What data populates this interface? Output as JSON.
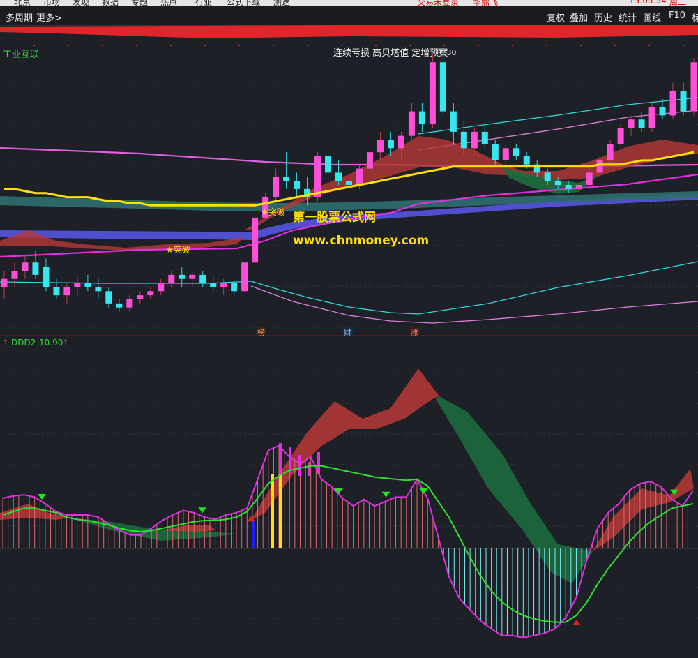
{
  "top_menu": {
    "items": [
      "北京",
      "市场",
      "发现",
      "数据",
      "专题",
      "热点",
      "行业",
      "公式下载",
      "测速"
    ],
    "notice": "交易未登录",
    "brand": "华鼎飞",
    "clock": "15:05:54",
    "weekday": "周二"
  },
  "toolbar": {
    "left_items": [
      "多周期",
      "更多>"
    ],
    "right_items": [
      "复权",
      "叠加",
      "历史",
      "统计",
      "画线",
      "F10",
      "标"
    ]
  },
  "main_panel": {
    "stock_label": "工业互联",
    "event_title": "连续亏损 高贝塔值 定增预案",
    "price_label": "6.30",
    "breakout_labels": [
      "★突破",
      "★突破"
    ],
    "watermark_line1": "第一股票公式网",
    "watermark_line2": "www.chnmoney.com",
    "event_markers": [
      "榜",
      "财",
      "涨"
    ],
    "colors": {
      "bull": "#ff4fd8",
      "bear": "#39e6ef",
      "yellow": "#ffe000",
      "green": "#00a050",
      "blue_band": "#5a5af0",
      "teal_band": "#2f6e6e"
    }
  },
  "indicator_panel": {
    "name": "DDD2",
    "value": "10.90",
    "arrow": "↑"
  },
  "chart_data": [
    {
      "type": "candlestick",
      "candles": [
        {
          "o": 3.0,
          "h": 3.4,
          "l": 2.7,
          "c": 3.2
        },
        {
          "o": 3.2,
          "h": 3.6,
          "l": 3.0,
          "c": 3.4
        },
        {
          "o": 3.4,
          "h": 3.8,
          "l": 3.2,
          "c": 3.6
        },
        {
          "o": 3.6,
          "h": 3.9,
          "l": 3.2,
          "c": 3.3
        },
        {
          "o": 3.5,
          "h": 3.7,
          "l": 2.9,
          "c": 3.0
        },
        {
          "o": 3.0,
          "h": 3.2,
          "l": 2.7,
          "c": 2.8
        },
        {
          "o": 2.8,
          "h": 3.1,
          "l": 2.6,
          "c": 3.0
        },
        {
          "o": 3.0,
          "h": 3.3,
          "l": 2.8,
          "c": 3.1
        },
        {
          "o": 3.1,
          "h": 3.3,
          "l": 2.9,
          "c": 3.0
        },
        {
          "o": 3.0,
          "h": 3.2,
          "l": 2.7,
          "c": 2.9
        },
        {
          "o": 2.9,
          "h": 3.0,
          "l": 2.5,
          "c": 2.6
        },
        {
          "o": 2.6,
          "h": 2.7,
          "l": 2.4,
          "c": 2.5
        },
        {
          "o": 2.5,
          "h": 2.8,
          "l": 2.4,
          "c": 2.7
        },
        {
          "o": 2.7,
          "h": 2.9,
          "l": 2.6,
          "c": 2.8
        },
        {
          "o": 2.8,
          "h": 3.0,
          "l": 2.7,
          "c": 2.9
        },
        {
          "o": 2.9,
          "h": 3.2,
          "l": 2.8,
          "c": 3.1
        },
        {
          "o": 3.1,
          "h": 3.4,
          "l": 3.0,
          "c": 3.3
        },
        {
          "o": 3.3,
          "h": 3.5,
          "l": 3.0,
          "c": 3.2
        },
        {
          "o": 3.2,
          "h": 3.4,
          "l": 3.0,
          "c": 3.3
        },
        {
          "o": 3.3,
          "h": 3.4,
          "l": 3.0,
          "c": 3.1
        },
        {
          "o": 3.1,
          "h": 3.3,
          "l": 2.9,
          "c": 3.0
        },
        {
          "o": 3.0,
          "h": 3.2,
          "l": 2.8,
          "c": 3.1
        },
        {
          "o": 3.1,
          "h": 3.2,
          "l": 2.8,
          "c": 2.9
        },
        {
          "o": 2.9,
          "h": 3.6,
          "l": 2.9,
          "c": 3.6
        },
        {
          "o": 3.6,
          "h": 4.8,
          "l": 3.6,
          "c": 4.7
        },
        {
          "o": 4.7,
          "h": 5.3,
          "l": 4.7,
          "c": 5.2
        },
        {
          "o": 5.2,
          "h": 5.9,
          "l": 5.0,
          "c": 5.7
        },
        {
          "o": 5.7,
          "h": 6.3,
          "l": 5.4,
          "c": 5.6
        },
        {
          "o": 5.6,
          "h": 5.8,
          "l": 5.2,
          "c": 5.4
        },
        {
          "o": 5.4,
          "h": 5.7,
          "l": 5.0,
          "c": 5.2
        },
        {
          "o": 5.2,
          "h": 6.3,
          "l": 5.1,
          "c": 6.2
        },
        {
          "o": 6.2,
          "h": 6.4,
          "l": 5.7,
          "c": 5.8
        },
        {
          "o": 5.8,
          "h": 6.1,
          "l": 5.5,
          "c": 5.6
        },
        {
          "o": 5.6,
          "h": 5.9,
          "l": 5.3,
          "c": 5.5
        },
        {
          "o": 5.5,
          "h": 6.0,
          "l": 5.4,
          "c": 5.9
        },
        {
          "o": 5.9,
          "h": 6.4,
          "l": 5.8,
          "c": 6.3
        },
        {
          "o": 6.3,
          "h": 6.8,
          "l": 6.1,
          "c": 6.6
        },
        {
          "o": 6.6,
          "h": 6.8,
          "l": 6.2,
          "c": 6.4
        },
        {
          "o": 6.4,
          "h": 6.8,
          "l": 6.1,
          "c": 6.7
        },
        {
          "o": 6.7,
          "h": 7.5,
          "l": 6.6,
          "c": 7.3
        },
        {
          "o": 7.3,
          "h": 7.5,
          "l": 6.8,
          "c": 7.0
        },
        {
          "o": 7.0,
          "h": 8.7,
          "l": 6.9,
          "c": 8.5
        },
        {
          "o": 8.5,
          "h": 8.7,
          "l": 7.2,
          "c": 7.3
        },
        {
          "o": 7.3,
          "h": 7.5,
          "l": 6.5,
          "c": 6.8
        },
        {
          "o": 6.8,
          "h": 7.1,
          "l": 6.2,
          "c": 6.4
        },
        {
          "o": 6.4,
          "h": 6.9,
          "l": 6.2,
          "c": 6.8
        },
        {
          "o": 6.8,
          "h": 7.0,
          "l": 6.4,
          "c": 6.5
        },
        {
          "o": 6.5,
          "h": 6.6,
          "l": 6.0,
          "c": 6.1
        },
        {
          "o": 6.1,
          "h": 6.5,
          "l": 5.9,
          "c": 6.4
        },
        {
          "o": 6.4,
          "h": 6.5,
          "l": 6.1,
          "c": 6.2
        },
        {
          "o": 6.2,
          "h": 6.3,
          "l": 5.9,
          "c": 6.0
        },
        {
          "o": 6.0,
          "h": 6.1,
          "l": 5.7,
          "c": 5.8
        },
        {
          "o": 5.8,
          "h": 5.9,
          "l": 5.5,
          "c": 5.6
        },
        {
          "o": 5.6,
          "h": 5.7,
          "l": 5.4,
          "c": 5.5
        },
        {
          "o": 5.5,
          "h": 5.6,
          "l": 5.3,
          "c": 5.4
        },
        {
          "o": 5.4,
          "h": 5.6,
          "l": 5.3,
          "c": 5.5
        },
        {
          "o": 5.5,
          "h": 5.9,
          "l": 5.4,
          "c": 5.8
        },
        {
          "o": 5.8,
          "h": 6.2,
          "l": 5.7,
          "c": 6.1
        },
        {
          "o": 6.1,
          "h": 6.6,
          "l": 6.0,
          "c": 6.5
        },
        {
          "o": 6.5,
          "h": 7.0,
          "l": 6.4,
          "c": 6.9
        },
        {
          "o": 6.9,
          "h": 7.2,
          "l": 6.7,
          "c": 7.1
        },
        {
          "o": 7.1,
          "h": 7.3,
          "l": 6.8,
          "c": 6.9
        },
        {
          "o": 6.9,
          "h": 7.5,
          "l": 6.8,
          "c": 7.4
        },
        {
          "o": 7.4,
          "h": 7.6,
          "l": 7.1,
          "c": 7.2
        },
        {
          "o": 7.2,
          "h": 8.0,
          "l": 7.1,
          "c": 7.8
        },
        {
          "o": 7.8,
          "h": 8.0,
          "l": 7.2,
          "c": 7.3
        },
        {
          "o": 7.3,
          "h": 8.6,
          "l": 7.2,
          "c": 8.5
        }
      ],
      "ma_yellow": [
        5.4,
        5.4,
        5.35,
        5.3,
        5.3,
        5.25,
        5.2,
        5.2,
        5.2,
        5.15,
        5.1,
        5.1,
        5.05,
        5.05,
        5.0,
        5.0,
        5.0,
        5.0,
        5.0,
        5.0,
        5.0,
        5.0,
        5.0,
        5.0,
        5.0,
        5.05,
        5.1,
        5.15,
        5.2,
        5.25,
        5.3,
        5.35,
        5.4,
        5.45,
        5.5,
        5.55,
        5.6,
        5.65,
        5.7,
        5.75,
        5.8,
        5.85,
        5.9,
        5.95,
        5.95,
        5.95,
        5.95,
        5.95,
        5.95,
        5.95,
        5.95,
        5.95,
        5.95,
        5.95,
        5.95,
        5.95,
        5.95,
        6.0,
        6.0,
        6.0,
        6.05,
        6.1,
        6.1,
        6.15,
        6.2,
        6.25,
        6.3
      ]
    },
    {
      "type": "oscillator",
      "title": "DDD2",
      "magenta_line": [
        45,
        47,
        48,
        46,
        40,
        33,
        30,
        30,
        30,
        28,
        22,
        16,
        12,
        12,
        18,
        25,
        30,
        34,
        32,
        28,
        26,
        30,
        32,
        36,
        62,
        88,
        92,
        82,
        76,
        82,
        62,
        55,
        45,
        38,
        44,
        38,
        42,
        46,
        46,
        62,
        45,
        10,
        -25,
        -45,
        -55,
        -65,
        -72,
        -78,
        -78,
        -80,
        -78,
        -76,
        -72,
        -62,
        -44,
        -10,
        18,
        32,
        40,
        52,
        58,
        60,
        55,
        44,
        38,
        52
      ],
      "green_line": [
        30,
        33,
        36,
        36,
        34,
        32,
        28,
        26,
        25,
        23,
        21,
        18,
        16,
        15,
        16,
        18,
        20,
        22,
        24,
        25,
        25,
        26,
        28,
        33,
        45,
        58,
        65,
        70,
        72,
        74,
        74,
        72,
        70,
        68,
        66,
        64,
        63,
        62,
        61,
        62,
        56,
        42,
        28,
        10,
        -8,
        -25,
        -38,
        -48,
        -55,
        -60,
        -63,
        -65,
        -66,
        -66,
        -60,
        -48,
        -32,
        -18,
        -6,
        6,
        16,
        24,
        30,
        36,
        38,
        40
      ],
      "signals_down": [
        0.06,
        0.29,
        0.485,
        0.553,
        0.607,
        0.966
      ],
      "signals_up": [
        0.36,
        0.826
      ]
    }
  ]
}
